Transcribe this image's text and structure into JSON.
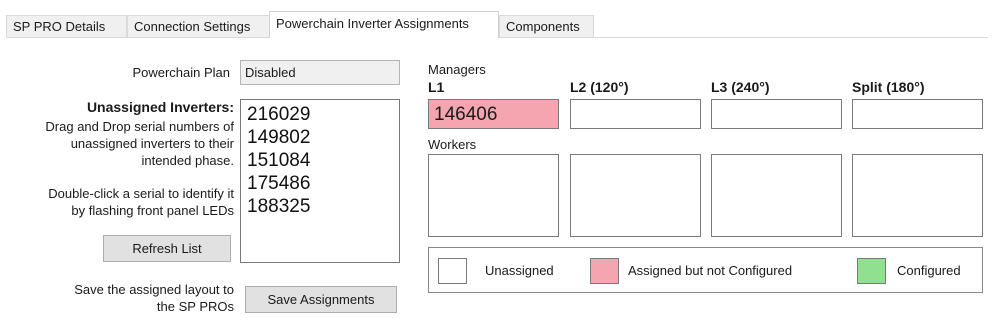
{
  "tabs": [
    {
      "label": "SP PRO Details",
      "active": false
    },
    {
      "label": "Connection Settings",
      "active": false
    },
    {
      "label": "Powerchain Inverter Assignments",
      "active": true
    },
    {
      "label": "Components",
      "active": false
    }
  ],
  "plan": {
    "label": "Powerchain Plan",
    "value": "Disabled"
  },
  "unassigned": {
    "title": "Unassigned Inverters:",
    "help1": [
      "Drag and Drop serial numbers of",
      "unassigned inverters to their",
      "intended phase."
    ],
    "help2": [
      "Double-click a serial to identify it",
      "by flashing front panel LEDs"
    ],
    "serials": [
      "216029",
      "149802",
      "151084",
      "175486",
      "188325"
    ],
    "refresh_label": "Refresh List"
  },
  "save": {
    "text": [
      "Save the assigned layout to",
      "the SP PROs"
    ],
    "button_label": "Save Assignments"
  },
  "phases": {
    "managers_label": "Managers",
    "workers_label": "Workers",
    "columns": [
      "L1",
      "L2 (120°)",
      "L3 (240°)",
      "Split (180°)"
    ],
    "manager_values": [
      "146406",
      "",
      "",
      ""
    ]
  },
  "legend": {
    "unassigned": "Unassigned",
    "assigned_not_configured": "Assigned but not Configured",
    "configured": "Configured"
  },
  "colors": {
    "assigned_not_configured": "#f4a5b0",
    "configured": "#8fe08f",
    "unassigned": "#ffffff"
  }
}
